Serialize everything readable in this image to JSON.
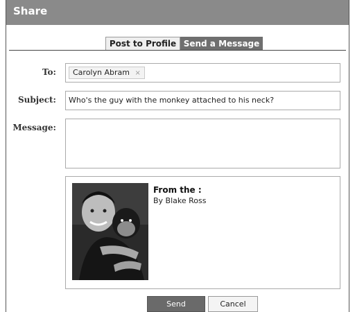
{
  "dialog": {
    "title": "Share"
  },
  "tabs": [
    {
      "label": "Post to Profile",
      "active": false
    },
    {
      "label": "Send a Message",
      "active": true
    }
  ],
  "form": {
    "to_label": "To:",
    "to_recipient": "Carolyn Abram",
    "to_remove_glyph": "×",
    "subject_label": "Subject:",
    "subject_value": "Who's the guy with the monkey attached to his neck?",
    "message_label": "Message:",
    "message_value": ""
  },
  "attachment": {
    "title": "From the :",
    "author": "By Blake Ross",
    "image_description_icon": "photo-thumbnail"
  },
  "buttons": {
    "send": "Send",
    "cancel": "Cancel"
  },
  "colors": {
    "titlebar": "#8a8a8a",
    "active_tab": "#6f6f6f",
    "send_button": "#6a6a6a"
  }
}
